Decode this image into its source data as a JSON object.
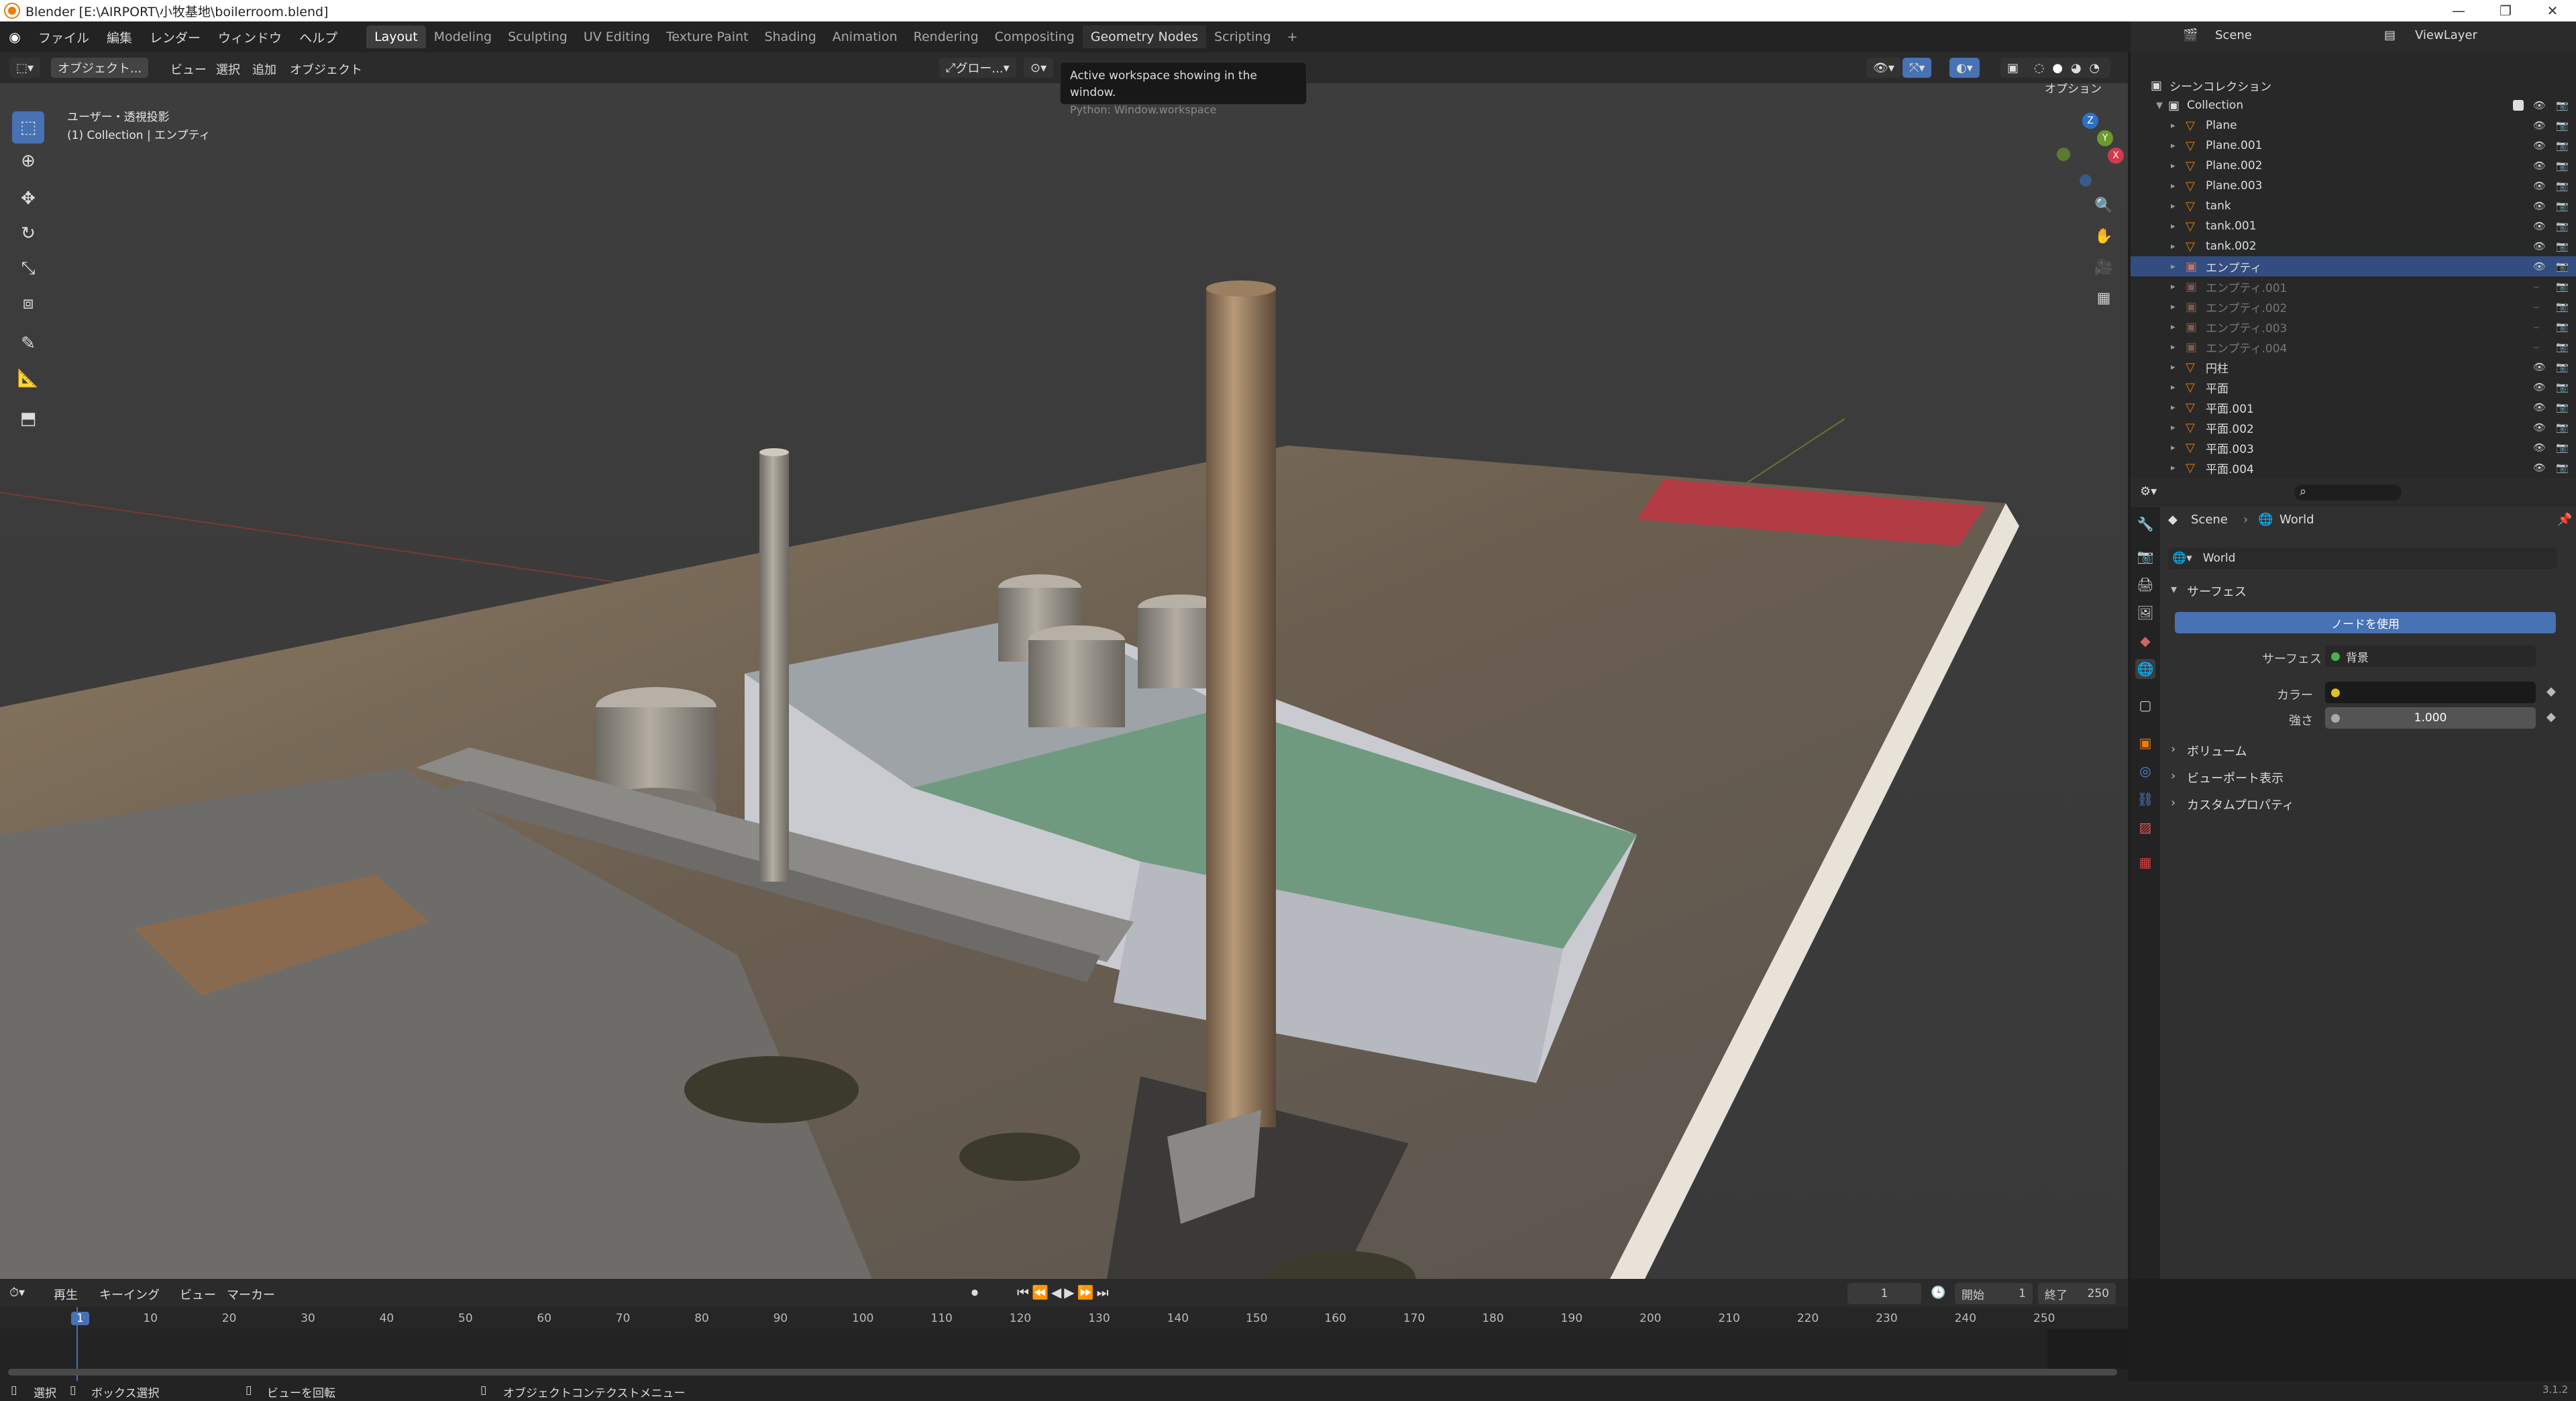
{
  "window": {
    "title": "Blender [E:\\AIRPORT\\小牧基地\\boilerroom.blend]"
  },
  "menu": [
    "ファイル",
    "編集",
    "レンダー",
    "ウィンドウ",
    "ヘルプ"
  ],
  "workspaces": [
    "Layout",
    "Modeling",
    "Sculpting",
    "UV Editing",
    "Texture Paint",
    "Shading",
    "Animation",
    "Rendering",
    "Compositing",
    "Geometry Nodes",
    "Scripting",
    "+"
  ],
  "active_workspace": "Layout",
  "scene_selector": {
    "scene": "Scene",
    "view_layer": "ViewLayer"
  },
  "viewport_header": {
    "mode": "オブジェクト...",
    "menus": [
      "ビュー",
      "選択",
      "追加",
      "オブジェクト"
    ],
    "transform": "グロー...",
    "options": "オプション"
  },
  "viewport_info": {
    "line1": "ユーザー・透視投影",
    "line2": "(1) Collection | エンプティ"
  },
  "tooltip": {
    "text": "Active workspace showing in the window.",
    "python": "Python: Window.workspace"
  },
  "gizmo": {
    "x": "X",
    "y": "Y",
    "z": "Z"
  },
  "outliner": {
    "title": "シーンコレクション",
    "collection": "Collection",
    "items": [
      {
        "name": "Plane",
        "type": "mesh",
        "visible": true,
        "selected": false
      },
      {
        "name": "Plane.001",
        "type": "mesh",
        "visible": true,
        "selected": false
      },
      {
        "name": "Plane.002",
        "type": "mesh",
        "visible": true,
        "selected": false
      },
      {
        "name": "Plane.003",
        "type": "mesh",
        "visible": true,
        "selected": false
      },
      {
        "name": "tank",
        "type": "mesh",
        "visible": true,
        "selected": false
      },
      {
        "name": "tank.001",
        "type": "mesh",
        "visible": true,
        "selected": false
      },
      {
        "name": "tank.002",
        "type": "mesh",
        "visible": true,
        "selected": false
      },
      {
        "name": "エンプティ",
        "type": "empty",
        "visible": true,
        "selected": true
      },
      {
        "name": "エンプティ.001",
        "type": "empty",
        "visible": false,
        "selected": false
      },
      {
        "name": "エンプティ.002",
        "type": "empty",
        "visible": false,
        "selected": false
      },
      {
        "name": "エンプティ.003",
        "type": "empty",
        "visible": false,
        "selected": false
      },
      {
        "name": "エンプティ.004",
        "type": "empty",
        "visible": false,
        "selected": false
      },
      {
        "name": "円柱",
        "type": "mesh",
        "visible": true,
        "selected": false
      },
      {
        "name": "平面",
        "type": "mesh",
        "visible": true,
        "selected": false
      },
      {
        "name": "平面.001",
        "type": "mesh",
        "visible": true,
        "selected": false
      },
      {
        "name": "平面.002",
        "type": "mesh",
        "visible": true,
        "selected": false
      },
      {
        "name": "平面.003",
        "type": "mesh",
        "visible": true,
        "selected": false
      },
      {
        "name": "平面.004",
        "type": "mesh",
        "visible": true,
        "selected": false
      }
    ]
  },
  "properties": {
    "breadcrumb": [
      "Scene",
      "World"
    ],
    "world_name": "World",
    "surface_panel": "サーフェス",
    "use_nodes_button": "ノードを使用",
    "surface_label": "サーフェス",
    "surface_value": "背景",
    "color_label": "カラー",
    "strength_label": "強さ",
    "strength_value": "1.000",
    "volume_panel": "ボリューム",
    "viewport_display_panel": "ビューポート表示",
    "custom_props_panel": "カスタムプロパティ"
  },
  "timeline": {
    "menus": [
      "再生",
      "キーイング",
      "ビュー",
      "マーカー"
    ],
    "current_frame": "1",
    "start_label": "開始",
    "start": "1",
    "end_label": "終了",
    "end": "250",
    "ticks": [
      "1",
      "10",
      "20",
      "30",
      "40",
      "50",
      "60",
      "70",
      "80",
      "90",
      "100",
      "110",
      "120",
      "130",
      "140",
      "150",
      "160",
      "170",
      "180",
      "190",
      "200",
      "210",
      "220",
      "230",
      "240",
      "250"
    ]
  },
  "statusbar": {
    "select": "選択",
    "box_select": "ボックス選択",
    "rotate_view": "ビューを回転",
    "context_menu": "オブジェクトコンテクストメニュー",
    "version": "3.1.2"
  },
  "colors": {
    "accent": "#4772b3",
    "selection": "#334d80",
    "mesh_icon": "#e87d0d",
    "orange_active": "#f5a623"
  }
}
